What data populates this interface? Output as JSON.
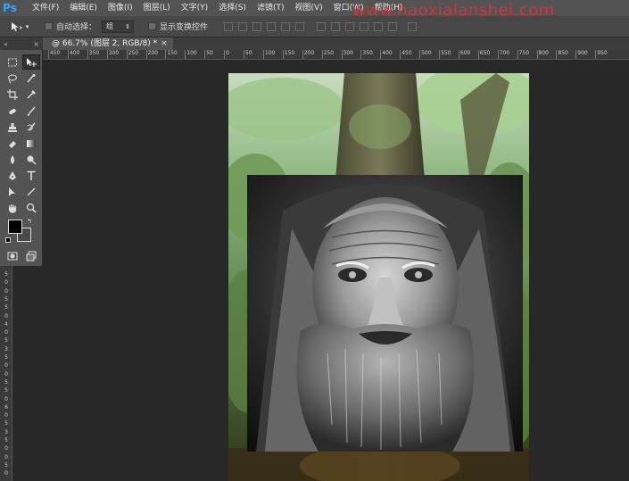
{
  "app": {
    "logo": "Ps",
    "menu": [
      "文件(F)",
      "编辑(E)",
      "图像(I)",
      "图层(L)",
      "文字(Y)",
      "选择(S)",
      "滤镜(T)",
      "视图(V)",
      "窗口(W)",
      "帮助(H)"
    ],
    "watermark": "www.haoxialanshei.com"
  },
  "options": {
    "auto_select_label": "自动选择：",
    "auto_select_value": "组",
    "show_transform_label": "显示变换控件"
  },
  "document": {
    "tab_title": "@ 66.7% (图层 2, RGB/8) *",
    "close_glyph": "×"
  },
  "toolbox": {
    "collapse_glyph": "«",
    "close_glyph": "×"
  },
  "ruler": {
    "top_ticks": [
      "450",
      "400",
      "350",
      "300",
      "250",
      "200",
      "150",
      "100",
      "50",
      "0",
      "50",
      "100",
      "150",
      "200",
      "250",
      "300",
      "350",
      "400",
      "450",
      "500",
      "550",
      "600",
      "650",
      "700",
      "750",
      "800",
      "850",
      "900",
      "950"
    ],
    "left_ticks": [
      "5",
      "0",
      "0",
      "5",
      "5",
      "0",
      "4",
      "0",
      "5",
      "3",
      "5",
      "0",
      "0",
      "5",
      "5",
      "0",
      "6",
      "0",
      "5",
      "3",
      "5",
      "0",
      "0",
      "5",
      "0"
    ]
  },
  "colors": {
    "foreground": "#000000",
    "background": "#4a4a4a",
    "accent": "#31a8ff",
    "watermark": "#e0313b"
  }
}
